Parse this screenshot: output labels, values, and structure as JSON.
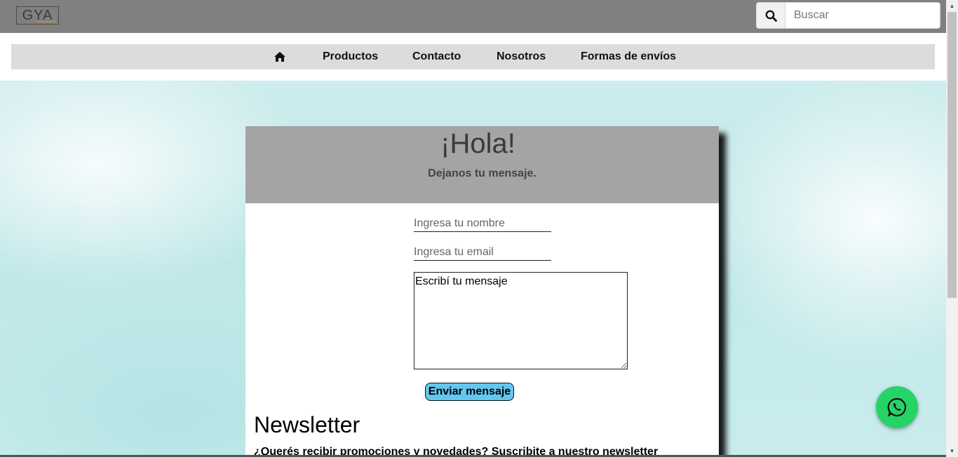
{
  "header": {
    "logo_text": "GYA",
    "search": {
      "placeholder": "Buscar",
      "value": ""
    }
  },
  "nav": {
    "items": [
      {
        "label": "Productos"
      },
      {
        "label": "Contacto"
      },
      {
        "label": "Nosotros"
      },
      {
        "label": "Formas de envíos"
      }
    ]
  },
  "contact": {
    "title": "¡Hola!",
    "subtitle": "Dejanos tu mensaje.",
    "name_placeholder": "Ingresa tu nombre",
    "email_placeholder": "Ingresa tu email",
    "message_value": "Escribí tu mensaje",
    "submit_label": "Enviar mensaje"
  },
  "newsletter": {
    "title": "Newsletter",
    "subtitle": "¿Querés recibir promociones y novedades? Suscribite a nuestro newsletter"
  },
  "colors": {
    "topbar": "#808080",
    "nav_bg": "#dcdcdc",
    "card_header": "#a4a4a4",
    "submit_button": "#63c7ef",
    "whatsapp": "#25d366"
  },
  "icons": [
    "search-icon",
    "home-icon",
    "whatsapp-icon",
    "resize-grip-icon"
  ]
}
